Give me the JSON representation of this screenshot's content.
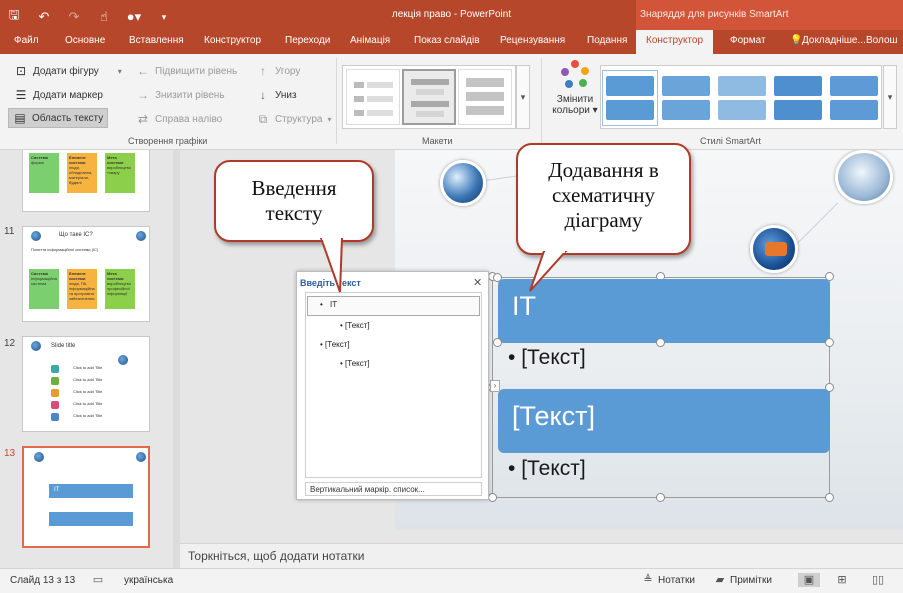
{
  "app": {
    "title": "лекція право - PowerPoint",
    "context_title": "Знаряддя для рисунків SmartArt",
    "accent": "#b7472a"
  },
  "qat": {
    "save": "save-icon",
    "undo": "undo-icon",
    "redo": "redo-icon",
    "touch": "touch-mode-icon",
    "user": "user-icon"
  },
  "tabs": {
    "file": "Файл",
    "home": "Основне",
    "insert": "Вставлення",
    "design": "Конструктор",
    "transitions": "Переходи",
    "animations": "Анімація",
    "slideshow": "Показ слайдів",
    "review": "Рецензування",
    "view": "Подання",
    "smartart_design": "Конструктор",
    "format": "Формат",
    "tellme": "Докладніше...",
    "user": "Волош"
  },
  "ribbon": {
    "create_graphic": {
      "add_shape": "Додати фігуру",
      "add_bullet": "Додати маркер",
      "text_pane": "Область тексту",
      "promote": "Підвищити рівень",
      "demote": "Знизити рівень",
      "right_to_left": "Справа наліво",
      "move_up": "Угору",
      "move_down": "Униз",
      "layout": "Структура",
      "group_label": "Створення графіки"
    },
    "layouts": {
      "group_label": "Макети"
    },
    "styles": {
      "change_colors_line1": "Змінити",
      "change_colors_line2": "кольори",
      "group_label": "Стилі SmartArt"
    }
  },
  "thumbnails": [
    {
      "number": "",
      "cards": [
        {
          "title": "Система",
          "text": "форма",
          "color": "#7ccf6e"
        },
        {
          "title": "Елемент системи",
          "text": "люди, обладнання, матеріали, будівлі",
          "color": "#f6b33f"
        },
        {
          "title": "Мета системи",
          "text": "виробництво товару",
          "color": "#8ccf4a"
        }
      ]
    },
    {
      "number": "11",
      "title": "Що таке ІС?",
      "subtitle": "Поняття інформаційної системи (ІС)",
      "cards": [
        {
          "title": "Система",
          "text": "Інформаційна система",
          "color": "#7ccf6e"
        },
        {
          "title": "Елемент системи",
          "text": "люди, ПК, інформаційна та програмна забезпечення",
          "color": "#f6b33f"
        },
        {
          "title": "Мета системи",
          "text": "виробництво професійної інформації",
          "color": "#8ccf4a"
        }
      ]
    },
    {
      "number": "12",
      "title": "Slide title",
      "items": [
        "Click to add Title",
        "Click to add Title",
        "Click to add Title",
        "Click to add Title",
        "Click to add Title"
      ],
      "item_colors": [
        "#3aa9a0",
        "#6bb03d",
        "#e99a2c",
        "#d84c7a",
        "#4a86c8"
      ]
    },
    {
      "number": "13",
      "box_label": "IT",
      "active": true
    }
  ],
  "text_pane": {
    "title": "Введіть текст",
    "close": "close-icon",
    "rows": [
      "IT",
      "[Текст]",
      "[Текст]",
      "[Текст]"
    ],
    "footer": "Вертикальний маркір. список..."
  },
  "smartart": {
    "box1": "IT",
    "bullet1": "[Текст]",
    "box2": "[Текст]",
    "bullet2": "[Текст]",
    "color": "#5b9bd5"
  },
  "callouts": {
    "left_line1": "Введення",
    "left_line2": "тексту",
    "right_line1": "Додавання в",
    "right_line2": "схематичну",
    "right_line3": "діаграму"
  },
  "notes": {
    "placeholder": "Торкніться, щоб додати нотатки"
  },
  "status": {
    "slide": "Слайд 13 з 13",
    "language": "українська",
    "notes": "Нотатки",
    "comments": "Примітки"
  }
}
